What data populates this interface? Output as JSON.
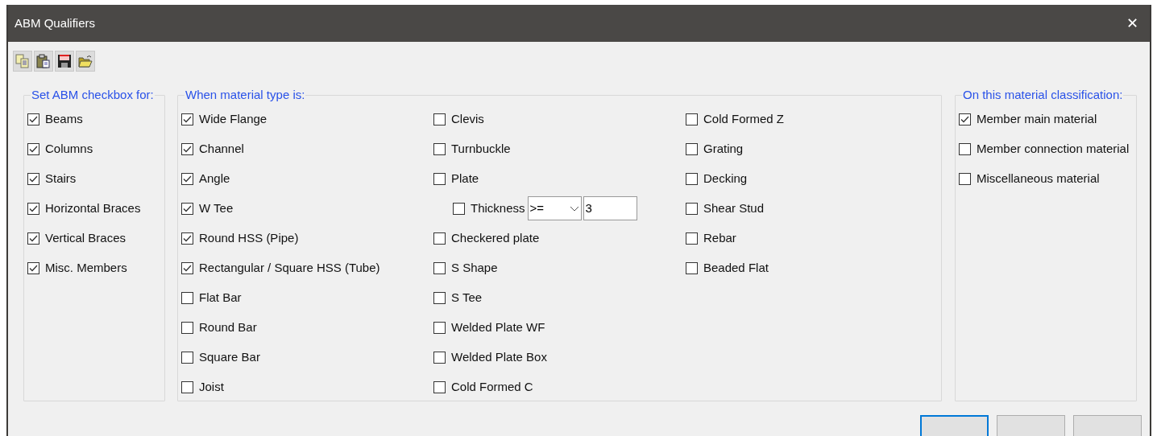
{
  "window": {
    "title": "ABM Qualifiers",
    "close": "✕"
  },
  "toolbar": [
    {
      "kind": "copy"
    },
    {
      "kind": "paste"
    },
    {
      "kind": "save"
    },
    {
      "kind": "open"
    }
  ],
  "member_group": {
    "legend": "Set ABM checkbox for:",
    "items": [
      {
        "label": "Beams",
        "checked": true
      },
      {
        "label": "Columns",
        "checked": true
      },
      {
        "label": "Stairs",
        "checked": true
      },
      {
        "label": "Horizontal Braces",
        "checked": true
      },
      {
        "label": "Vertical Braces",
        "checked": true
      },
      {
        "label": "Misc. Members",
        "checked": true
      }
    ]
  },
  "material_group": {
    "legend": "When material type is:",
    "columns": [
      [
        {
          "kind": "checkbox",
          "label": "Wide Flange",
          "checked": true
        },
        {
          "kind": "checkbox",
          "label": "Channel",
          "checked": true
        },
        {
          "kind": "checkbox",
          "label": "Angle",
          "checked": true
        },
        {
          "kind": "checkbox",
          "label": "W Tee",
          "checked": true
        },
        {
          "kind": "checkbox",
          "label": "Round HSS (Pipe)",
          "checked": true
        },
        {
          "kind": "checkbox",
          "label": "Rectangular / Square HSS (Tube)",
          "checked": true
        },
        {
          "kind": "checkbox",
          "label": "Flat Bar",
          "checked": false
        },
        {
          "kind": "checkbox",
          "label": "Round Bar",
          "checked": false
        },
        {
          "kind": "checkbox",
          "label": "Square Bar",
          "checked": false
        },
        {
          "kind": "checkbox",
          "label": "Joist",
          "checked": false
        }
      ],
      [
        {
          "kind": "checkbox",
          "label": "Clevis",
          "checked": false
        },
        {
          "kind": "checkbox",
          "label": "Turnbuckle",
          "checked": false
        },
        {
          "kind": "checkbox",
          "label": "Plate",
          "checked": false
        },
        {
          "kind": "threshold",
          "label": "Thickness",
          "checked": false,
          "operator": ">=",
          "value": "3"
        },
        {
          "kind": "checkbox",
          "label": "Checkered plate",
          "checked": false
        },
        {
          "kind": "checkbox",
          "label": "S Shape",
          "checked": false
        },
        {
          "kind": "checkbox",
          "label": "S Tee",
          "checked": false
        },
        {
          "kind": "checkbox",
          "label": "Welded Plate WF",
          "checked": false
        },
        {
          "kind": "checkbox",
          "label": "Welded Plate Box",
          "checked": false
        },
        {
          "kind": "checkbox",
          "label": "Cold Formed C",
          "checked": false
        }
      ],
      [
        {
          "kind": "checkbox",
          "label": "Cold Formed Z",
          "checked": false
        },
        {
          "kind": "checkbox",
          "label": "Grating",
          "checked": false
        },
        {
          "kind": "checkbox",
          "label": "Decking",
          "checked": false
        },
        {
          "kind": "checkbox",
          "label": "Shear Stud",
          "checked": false
        },
        {
          "kind": "checkbox",
          "label": "Rebar",
          "checked": false
        },
        {
          "kind": "checkbox",
          "label": "Beaded Flat",
          "checked": false
        }
      ]
    ]
  },
  "classification_group": {
    "legend": "On this material classification:",
    "items": [
      {
        "label": "Member main material",
        "checked": true
      },
      {
        "label": "Member connection material",
        "checked": false
      },
      {
        "label": "Miscellaneous material",
        "checked": false
      }
    ]
  },
  "dialog_buttons": [
    {
      "focused": true
    },
    {
      "focused": false
    },
    {
      "focused": false
    }
  ]
}
